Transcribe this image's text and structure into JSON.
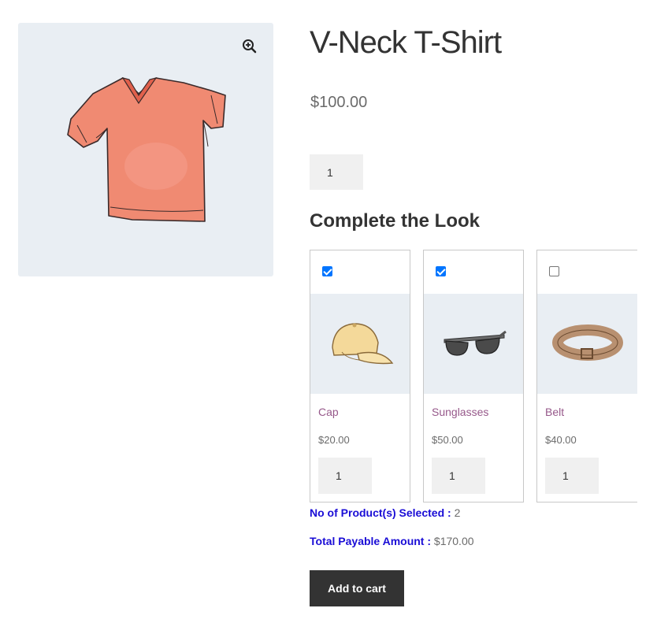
{
  "product": {
    "title": "V-Neck T-Shirt",
    "price": "$100.00",
    "quantity": "1",
    "image_icon": "tshirt-image",
    "zoom_icon": "zoom-in-icon"
  },
  "bundle": {
    "heading": "Complete the Look",
    "items": [
      {
        "name": "Cap",
        "price": "$20.00",
        "quantity": "1",
        "checked": true,
        "icon": "cap-image"
      },
      {
        "name": "Sunglasses",
        "price": "$50.00",
        "quantity": "1",
        "checked": true,
        "icon": "sunglasses-image"
      },
      {
        "name": "Belt",
        "price": "$40.00",
        "quantity": "1",
        "checked": false,
        "icon": "belt-image"
      }
    ],
    "selected_label": "No of Product(s) Selected :",
    "selected_count": "2",
    "total_label": "Total Payable Amount :",
    "total_value": "$170.00"
  },
  "actions": {
    "add_to_cart": "Add to cart"
  },
  "colors": {
    "link": "#96588a",
    "label_blue": "#1a0dd6",
    "button_bg": "#333333",
    "image_bg": "#e9eef3"
  }
}
